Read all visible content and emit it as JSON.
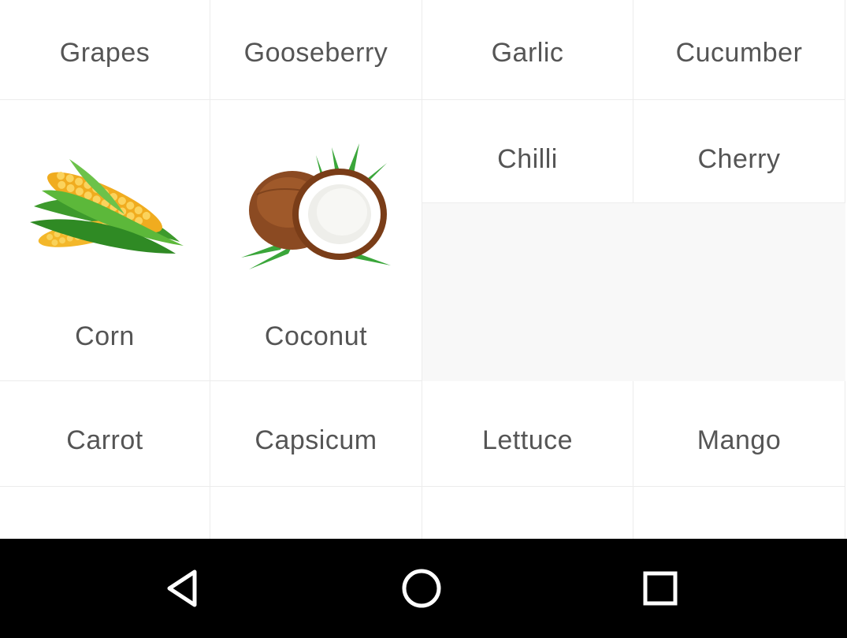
{
  "items": [
    {
      "label": "Grapes"
    },
    {
      "label": "Gooseberry"
    },
    {
      "label": "Garlic"
    },
    {
      "label": "Cucumber"
    },
    {
      "label": "Corn",
      "image": "corn-image"
    },
    {
      "label": "Coconut",
      "image": "coconut-image"
    },
    {
      "label": "Chilli"
    },
    {
      "label": "Cherry"
    },
    {
      "label": "Carrot"
    },
    {
      "label": "Capsicum"
    },
    {
      "label": "Lettuce"
    },
    {
      "label": "Mango"
    }
  ],
  "navigation": {
    "back_icon": "back-triangle-icon",
    "home_icon": "home-circle-icon",
    "recents_icon": "recents-square-icon"
  },
  "colors": {
    "label_text": "#555555",
    "grid_line": "#ececec",
    "empty_area": "#f8f8f8",
    "nav_bar": "#000000",
    "nav_icon": "#ffffff"
  }
}
